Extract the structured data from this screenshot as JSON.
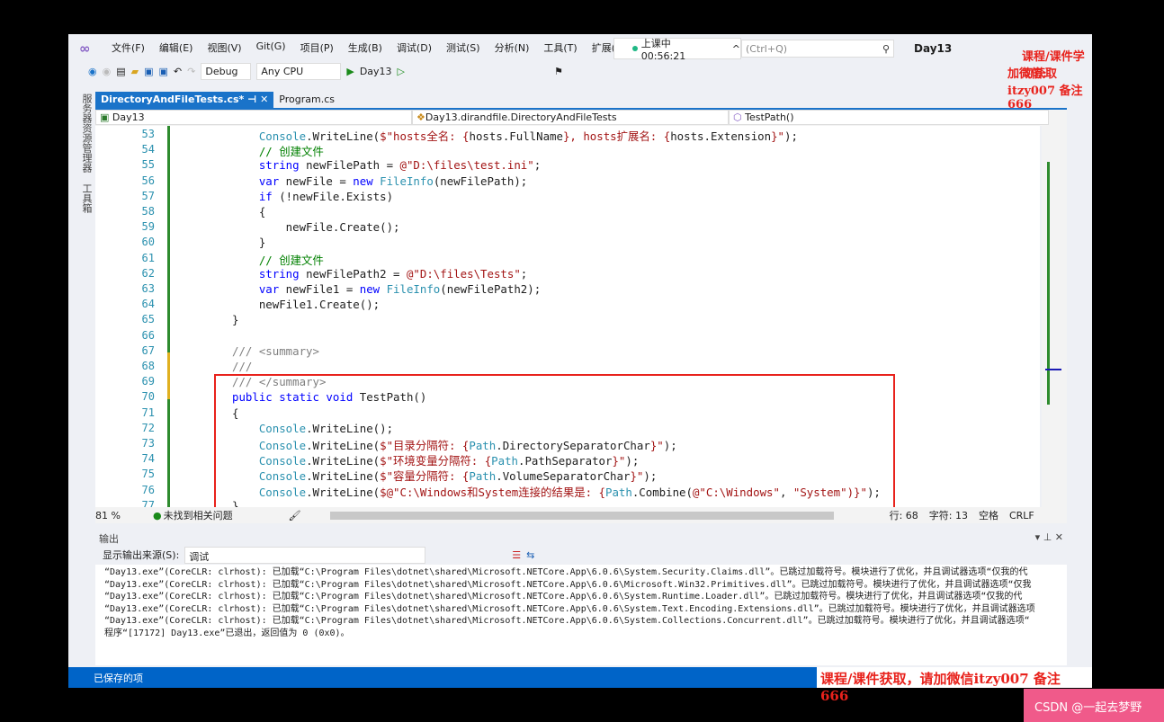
{
  "menu": [
    "文件(F)",
    "编辑(E)",
    "视图(V)",
    "Git(G)",
    "项目(P)",
    "生成(B)",
    "调试(D)",
    "测试(S)",
    "分析(N)",
    "工具(T)",
    "扩展(X)"
  ],
  "timer": "上课中 00:56:21",
  "search_placeholder": "(Ctrl+Q)",
  "solution": "Day13",
  "toolbar": {
    "config": "Debug",
    "platform": "Any CPU",
    "run": "Day13"
  },
  "tabs": [
    {
      "label": "DirectoryAndFileTests.cs*"
    },
    {
      "label": "Program.cs"
    }
  ],
  "navbar": {
    "project": "Day13",
    "class": "Day13.dirandfile.DirectoryAndFileTests",
    "member": "TestPath()"
  },
  "sidebar": {
    "a": "服务器资源管理器",
    "b": "工具箱"
  },
  "code": [
    {
      "n": "53",
      "t": [
        [
          "    Console",
          "ty"
        ],
        [
          ".WriteLine(",
          "pl"
        ],
        [
          "$\"hosts全名: {",
          "st"
        ],
        [
          "hosts.FullName",
          "pl"
        ],
        [
          "}, hosts扩展名: {",
          "st"
        ],
        [
          "hosts.Extension",
          "pl"
        ],
        [
          "}\"",
          "st"
        ],
        [
          ");",
          "pl"
        ]
      ]
    },
    {
      "n": "54",
      "t": [
        [
          "    // 创建文件",
          "cm"
        ]
      ]
    },
    {
      "n": "55",
      "t": [
        [
          "    string",
          "kw"
        ],
        [
          " newFilePath = ",
          "pl"
        ],
        [
          "@\"D:\\files\\test.ini\"",
          "st"
        ],
        [
          ";",
          "pl"
        ]
      ]
    },
    {
      "n": "56",
      "t": [
        [
          "    var",
          "kw"
        ],
        [
          " newFile = ",
          "pl"
        ],
        [
          "new ",
          "kw"
        ],
        [
          "FileInfo",
          "ty"
        ],
        [
          "(newFilePath);",
          "pl"
        ]
      ]
    },
    {
      "n": "57",
      "t": [
        [
          "    if",
          "kw"
        ],
        [
          " (!newFile.Exists)",
          "pl"
        ]
      ]
    },
    {
      "n": "58",
      "t": [
        [
          "    {",
          "pl"
        ]
      ]
    },
    {
      "n": "59",
      "t": [
        [
          "        newFile.Create();",
          "pl"
        ]
      ]
    },
    {
      "n": "60",
      "t": [
        [
          "    }",
          "pl"
        ]
      ]
    },
    {
      "n": "61",
      "t": [
        [
          "    // 创建文件",
          "cm"
        ]
      ]
    },
    {
      "n": "62",
      "t": [
        [
          "    string",
          "kw"
        ],
        [
          " newFilePath2 = ",
          "pl"
        ],
        [
          "@\"D:\\files\\Tests\"",
          "st"
        ],
        [
          ";",
          "pl"
        ]
      ]
    },
    {
      "n": "63",
      "t": [
        [
          "    var",
          "kw"
        ],
        [
          " newFile1 = ",
          "pl"
        ],
        [
          "new ",
          "kw"
        ],
        [
          "FileInfo",
          "ty"
        ],
        [
          "(newFilePath2);",
          "pl"
        ]
      ]
    },
    {
      "n": "64",
      "t": [
        [
          "    newFile1.Create();",
          "pl"
        ]
      ]
    },
    {
      "n": "65",
      "t": [
        [
          "}",
          "pl"
        ]
      ]
    },
    {
      "n": "66",
      "t": []
    },
    {
      "n": "67",
      "t": [
        [
          "/// <summary>",
          "dc"
        ]
      ]
    },
    {
      "n": "68",
      "t": [
        [
          "///",
          "dc"
        ]
      ]
    },
    {
      "n": "69",
      "t": [
        [
          "/// </summary>",
          "dc"
        ]
      ]
    },
    {
      "n": "70",
      "t": [
        [
          "public static void",
          "kw"
        ],
        [
          " TestPath()",
          "pl"
        ]
      ]
    },
    {
      "n": "71",
      "t": [
        [
          "{",
          "pl"
        ]
      ]
    },
    {
      "n": "72",
      "t": [
        [
          "    Console",
          "ty"
        ],
        [
          ".WriteLine();",
          "pl"
        ]
      ]
    },
    {
      "n": "73",
      "t": [
        [
          "    Console",
          "ty"
        ],
        [
          ".WriteLine(",
          "pl"
        ],
        [
          "$\"目录分隔符: {",
          "st"
        ],
        [
          "Path",
          "ty"
        ],
        [
          ".DirectorySeparatorChar",
          "pl"
        ],
        [
          "}\"",
          "st"
        ],
        [
          ");",
          "pl"
        ]
      ]
    },
    {
      "n": "74",
      "t": [
        [
          "    Console",
          "ty"
        ],
        [
          ".WriteLine(",
          "pl"
        ],
        [
          "$\"环境变量分隔符: {",
          "st"
        ],
        [
          "Path",
          "ty"
        ],
        [
          ".PathSeparator",
          "pl"
        ],
        [
          "}\"",
          "st"
        ],
        [
          ");",
          "pl"
        ]
      ]
    },
    {
      "n": "75",
      "t": [
        [
          "    Console",
          "ty"
        ],
        [
          ".WriteLine(",
          "pl"
        ],
        [
          "$\"容量分隔符: {",
          "st"
        ],
        [
          "Path",
          "ty"
        ],
        [
          ".VolumeSeparatorChar",
          "pl"
        ],
        [
          "}\"",
          "st"
        ],
        [
          ");",
          "pl"
        ]
      ]
    },
    {
      "n": "76",
      "t": [
        [
          "    Console",
          "ty"
        ],
        [
          ".WriteLine(",
          "pl"
        ],
        [
          "$@\"C:\\Windows和System连接的结果是: {",
          "st"
        ],
        [
          "Path",
          "ty"
        ],
        [
          ".Combine(",
          "pl"
        ],
        [
          "@\"C:\\Windows\"",
          "st"
        ],
        [
          ", ",
          "pl"
        ],
        [
          "\"System\"",
          "st"
        ],
        [
          ")}\"",
          "st"
        ],
        [
          ");",
          "pl"
        ]
      ]
    },
    {
      "n": "77",
      "t": [
        [
          "}",
          "pl"
        ]
      ]
    }
  ],
  "editor_status": {
    "zoom": "81 %",
    "issues": "未找到相关问题",
    "line": "行: 68",
    "char": "字符: 13",
    "spaces": "空格",
    "eol": "CRLF"
  },
  "output": {
    "title": "输出",
    "source_label": "显示输出来源(S):",
    "source": "调试",
    "lines": [
      "“Day13.exe”(CoreCLR: clrhost): 已加载“C:\\Program Files\\dotnet\\shared\\Microsoft.NETCore.App\\6.0.6\\System.Security.Claims.dll”。已跳过加载符号。模块进行了优化，并且调试器选项“仅我的代",
      "“Day13.exe”(CoreCLR: clrhost): 已加载“C:\\Program Files\\dotnet\\shared\\Microsoft.NETCore.App\\6.0.6\\Microsoft.Win32.Primitives.dll”。已跳过加载符号。模块进行了优化，并且调试器选项“仅我",
      "“Day13.exe”(CoreCLR: clrhost): 已加载“C:\\Program Files\\dotnet\\shared\\Microsoft.NETCore.App\\6.0.6\\System.Runtime.Loader.dll”。已跳过加载符号。模块进行了优化，并且调试器选项“仅我的代",
      "“Day13.exe”(CoreCLR: clrhost): 已加载“C:\\Program Files\\dotnet\\shared\\Microsoft.NETCore.App\\6.0.6\\System.Text.Encoding.Extensions.dll”。已跳过加载符号。模块进行了优化，并且调试器选项",
      "“Day13.exe”(CoreCLR: clrhost): 已加载“C:\\Program Files\\dotnet\\shared\\Microsoft.NETCore.App\\6.0.6\\System.Collections.Concurrent.dll”。已跳过加载符号。模块进行了优化，并且调试器选项“",
      "程序“[17172] Day13.exe”已退出，返回值为 0 (0x0)。"
    ]
  },
  "statusbar": "已保存的项",
  "watermarks": {
    "top1": "课程/课件学习获取",
    "top2": "加微信: itzy007 备注666",
    "bottom": "课程/课件获取，请加微信itzy007 备注666",
    "badge": "CSDN @一起去梦野"
  }
}
